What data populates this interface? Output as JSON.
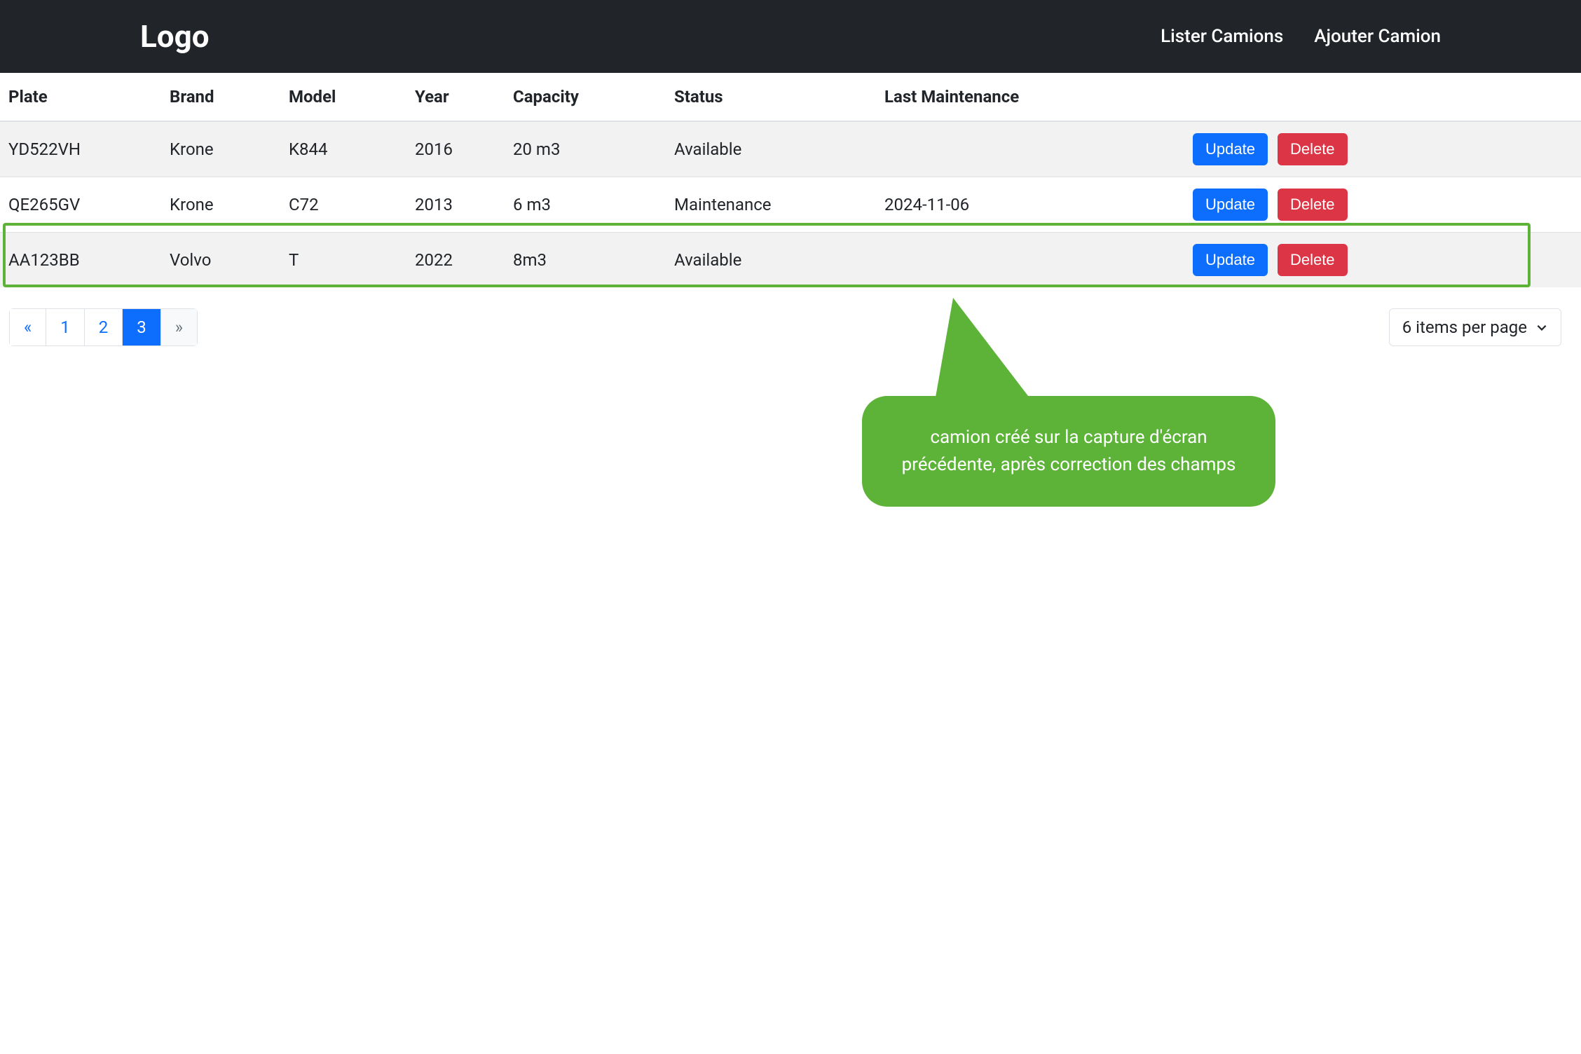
{
  "navbar": {
    "brand": "Logo",
    "links": [
      {
        "label": "Lister Camions"
      },
      {
        "label": "Ajouter Camion"
      }
    ]
  },
  "table": {
    "headers": {
      "plate": "Plate",
      "brand": "Brand",
      "model": "Model",
      "year": "Year",
      "capacity": "Capacity",
      "status": "Status",
      "last_maintenance": "Last Maintenance"
    },
    "rows": [
      {
        "plate": "YD522VH",
        "brand": "Krone",
        "model": "K844",
        "year": "2016",
        "capacity": "20 m3",
        "status": "Available",
        "last_maintenance": ""
      },
      {
        "plate": "QE265GV",
        "brand": "Krone",
        "model": "C72",
        "year": "2013",
        "capacity": "6 m3",
        "status": "Maintenance",
        "last_maintenance": "2024-11-06"
      },
      {
        "plate": "AA123BB",
        "brand": "Volvo",
        "model": "T",
        "year": "2022",
        "capacity": "8m3",
        "status": "Available",
        "last_maintenance": ""
      }
    ],
    "actions": {
      "update": "Update",
      "delete": "Delete"
    }
  },
  "pagination": {
    "prev": "«",
    "next": "»",
    "pages": [
      "1",
      "2",
      "3"
    ],
    "active": "3"
  },
  "items_per_page": {
    "label": "6 items per page"
  },
  "callout": {
    "text": "camion créé sur la capture d'écran précédente, après correction des champs"
  }
}
